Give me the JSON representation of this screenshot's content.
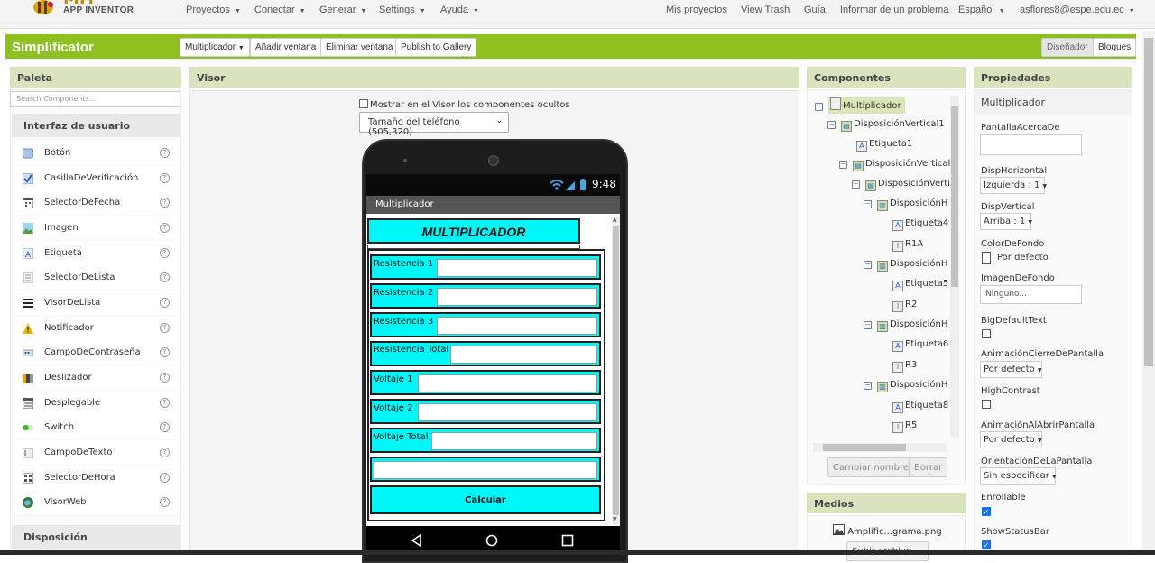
{
  "header": {
    "logo_top": "MIT",
    "logo_bottom": "APP INVENTOR",
    "nav": [
      "Proyectos",
      "Conectar",
      "Generar",
      "Settings",
      "Ayuda"
    ],
    "right_links": [
      "Mis proyectos",
      "View Trash",
      "Guía",
      "Informar de un problema"
    ],
    "language": "Español",
    "user": "asflores8@espe.edu.ec"
  },
  "toolbar": {
    "project_title": "Simplificator",
    "screen_select": "Multiplicador",
    "add_screen": "Añadir ventana",
    "remove_screen": "Eliminar ventana",
    "publish": "Publish to Gallery",
    "designer": "Diseñador",
    "blocks": "Bloques"
  },
  "palette": {
    "title": "Paleta",
    "search_placeholder": "Search Components...",
    "category_ui": "Interfaz de usuario",
    "category_layout": "Disposición",
    "items": [
      {
        "label": "Botón",
        "icon": "button-icon"
      },
      {
        "label": "CasillaDeVerificación",
        "icon": "checkbox-icon"
      },
      {
        "label": "SelectorDeFecha",
        "icon": "datepicker-icon"
      },
      {
        "label": "Imagen",
        "icon": "image-icon"
      },
      {
        "label": "Etiqueta",
        "icon": "label-icon"
      },
      {
        "label": "SelectorDeLista",
        "icon": "listpicker-icon"
      },
      {
        "label": "VisorDeLista",
        "icon": "listview-icon"
      },
      {
        "label": "Notificador",
        "icon": "notifier-icon"
      },
      {
        "label": "CampoDeContraseña",
        "icon": "password-icon"
      },
      {
        "label": "Deslizador",
        "icon": "slider-icon"
      },
      {
        "label": "Desplegable",
        "icon": "spinner-icon"
      },
      {
        "label": "Switch",
        "icon": "switch-icon"
      },
      {
        "label": "CampoDeTexto",
        "icon": "textbox-icon"
      },
      {
        "label": "SelectorDeHora",
        "icon": "timepicker-icon"
      },
      {
        "label": "VisorWeb",
        "icon": "webviewer-icon"
      }
    ],
    "help_glyph": "?"
  },
  "viewer": {
    "title": "Visor",
    "show_hidden": "Mostrar en el Visor los componentes ocultos",
    "phone_size": "Tamaño del teléfono (505,320)",
    "time": "9:48",
    "screen_title": "Multiplicador",
    "app_heading": "MULTIPLICADOR",
    "rows": [
      "Resistencia 1",
      "Resistencia 2",
      "Resistencia 3",
      "Resistencia Total",
      "Voltaje 1",
      "Voltaje 2",
      "Voltaje Total"
    ],
    "calc_button": "Calcular"
  },
  "components": {
    "title": "Componentes",
    "tree": [
      {
        "label": "Multiplicador",
        "level": 0,
        "toggle": true,
        "selected": true
      },
      {
        "label": "DisposiciónVertical1",
        "level": 1,
        "toggle": true
      },
      {
        "label": "Etiqueta1",
        "level": 2,
        "toggle": false
      },
      {
        "label": "DisposiciónVertical",
        "level": 2,
        "toggle": true
      },
      {
        "label": "DisposiciónVerti",
        "level": 3,
        "toggle": true
      },
      {
        "label": "DisposiciónH",
        "level": 4,
        "toggle": true
      },
      {
        "label": "Etiqueta4",
        "level": 5,
        "toggle": false
      },
      {
        "label": "R1A",
        "level": 5,
        "toggle": false
      },
      {
        "label": "DisposiciónH",
        "level": 4,
        "toggle": true
      },
      {
        "label": "Etiqueta5",
        "level": 5,
        "toggle": false
      },
      {
        "label": "R2",
        "level": 5,
        "toggle": false
      },
      {
        "label": "DisposiciónH",
        "level": 4,
        "toggle": true
      },
      {
        "label": "Etiqueta6",
        "level": 5,
        "toggle": false
      },
      {
        "label": "R3",
        "level": 5,
        "toggle": false
      },
      {
        "label": "DisposiciónH",
        "level": 4,
        "toggle": true
      },
      {
        "label": "Etiqueta8",
        "level": 5,
        "toggle": false
      },
      {
        "label": "R5",
        "level": 5,
        "toggle": false
      }
    ],
    "rename": "Cambiar nombre",
    "delete": "Borrar"
  },
  "media": {
    "title": "Medios",
    "file": "Amplific...grama.png",
    "upload": "Subir archivo ..."
  },
  "properties": {
    "title": "Propiedades",
    "component": "Multiplicador",
    "about_label": "PantallaAcercaDe",
    "halign_label": "DispHorizontal",
    "halign_value": "Izquierda : 1",
    "valign_label": "DispVertical",
    "valign_value": "Arriba : 1",
    "bgcolor_label": "ColorDeFondo",
    "bgcolor_value": "Por defecto",
    "bgimage_label": "ImagenDeFondo",
    "bgimage_value": "Ninguno...",
    "bigtext_label": "BigDefaultText",
    "close_anim_label": "AnimaciónCierreDePantalla",
    "close_anim_value": "Por defecto",
    "contrast_label": "HighContrast",
    "open_anim_label": "AnimaciónAlAbrirPantalla",
    "open_anim_value": "Por defecto",
    "orientation_label": "OrientaciónDeLaPantalla",
    "orientation_value": "Sin especificar",
    "scrollable_label": "Enrollable",
    "statusbar_label": "ShowStatusBar"
  },
  "colors": {
    "brand_green": "#8ec01f",
    "app_cyan": "#00f7f7",
    "panel_header": "#d9e4bf"
  }
}
